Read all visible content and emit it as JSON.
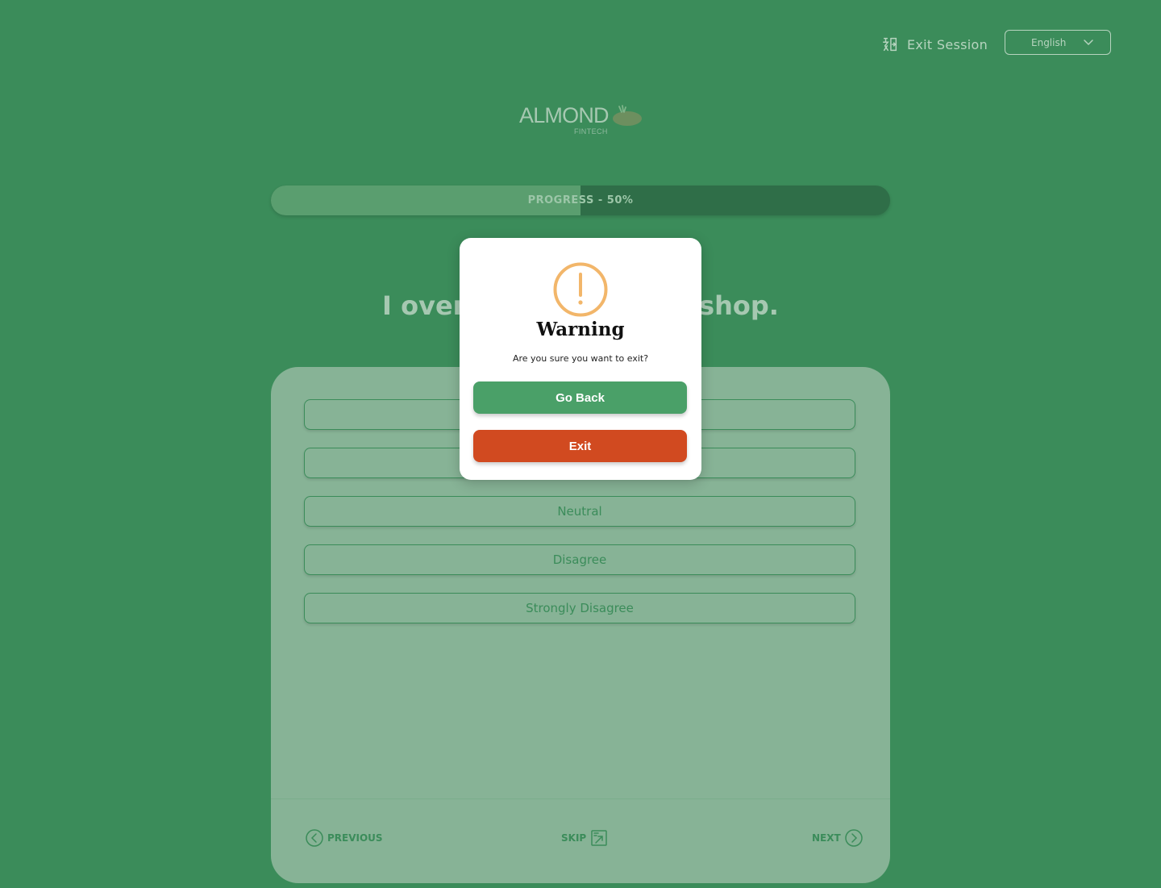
{
  "header": {
    "exit_session_label": "Exit Session",
    "language_selected": "English"
  },
  "logo": {
    "name": "ALMOND",
    "tagline": "FINTECH"
  },
  "progress": {
    "label": "PROGRESS - 50%",
    "percent": 50
  },
  "question": {
    "text": "I over                          shop."
  },
  "options": [
    {
      "label": ""
    },
    {
      "label": ""
    },
    {
      "label": "Neutral"
    },
    {
      "label": "Disagree"
    },
    {
      "label": "Strongly Disagree"
    }
  ],
  "navigation": {
    "previous_label": "PREVIOUS",
    "skip_label": "SKIP",
    "next_label": "NEXT"
  },
  "modal": {
    "title": "Warning",
    "message": "Are you sure you want to exit?",
    "go_back_label": "Go Back",
    "exit_label": "Exit"
  },
  "colors": {
    "background": "#3b8c5a",
    "card": "#87b396",
    "go_back_button": "#4aa068",
    "exit_button": "#d14a20",
    "warning_icon": "#f2b66a"
  },
  "icons": {
    "exit_session": "exit-session-icon",
    "language_dropdown": "chevron-down-icon",
    "previous": "chevron-left-circle-icon",
    "skip": "skip-icon",
    "next": "chevron-right-circle-icon",
    "warning": "exclamation-circle-icon"
  }
}
